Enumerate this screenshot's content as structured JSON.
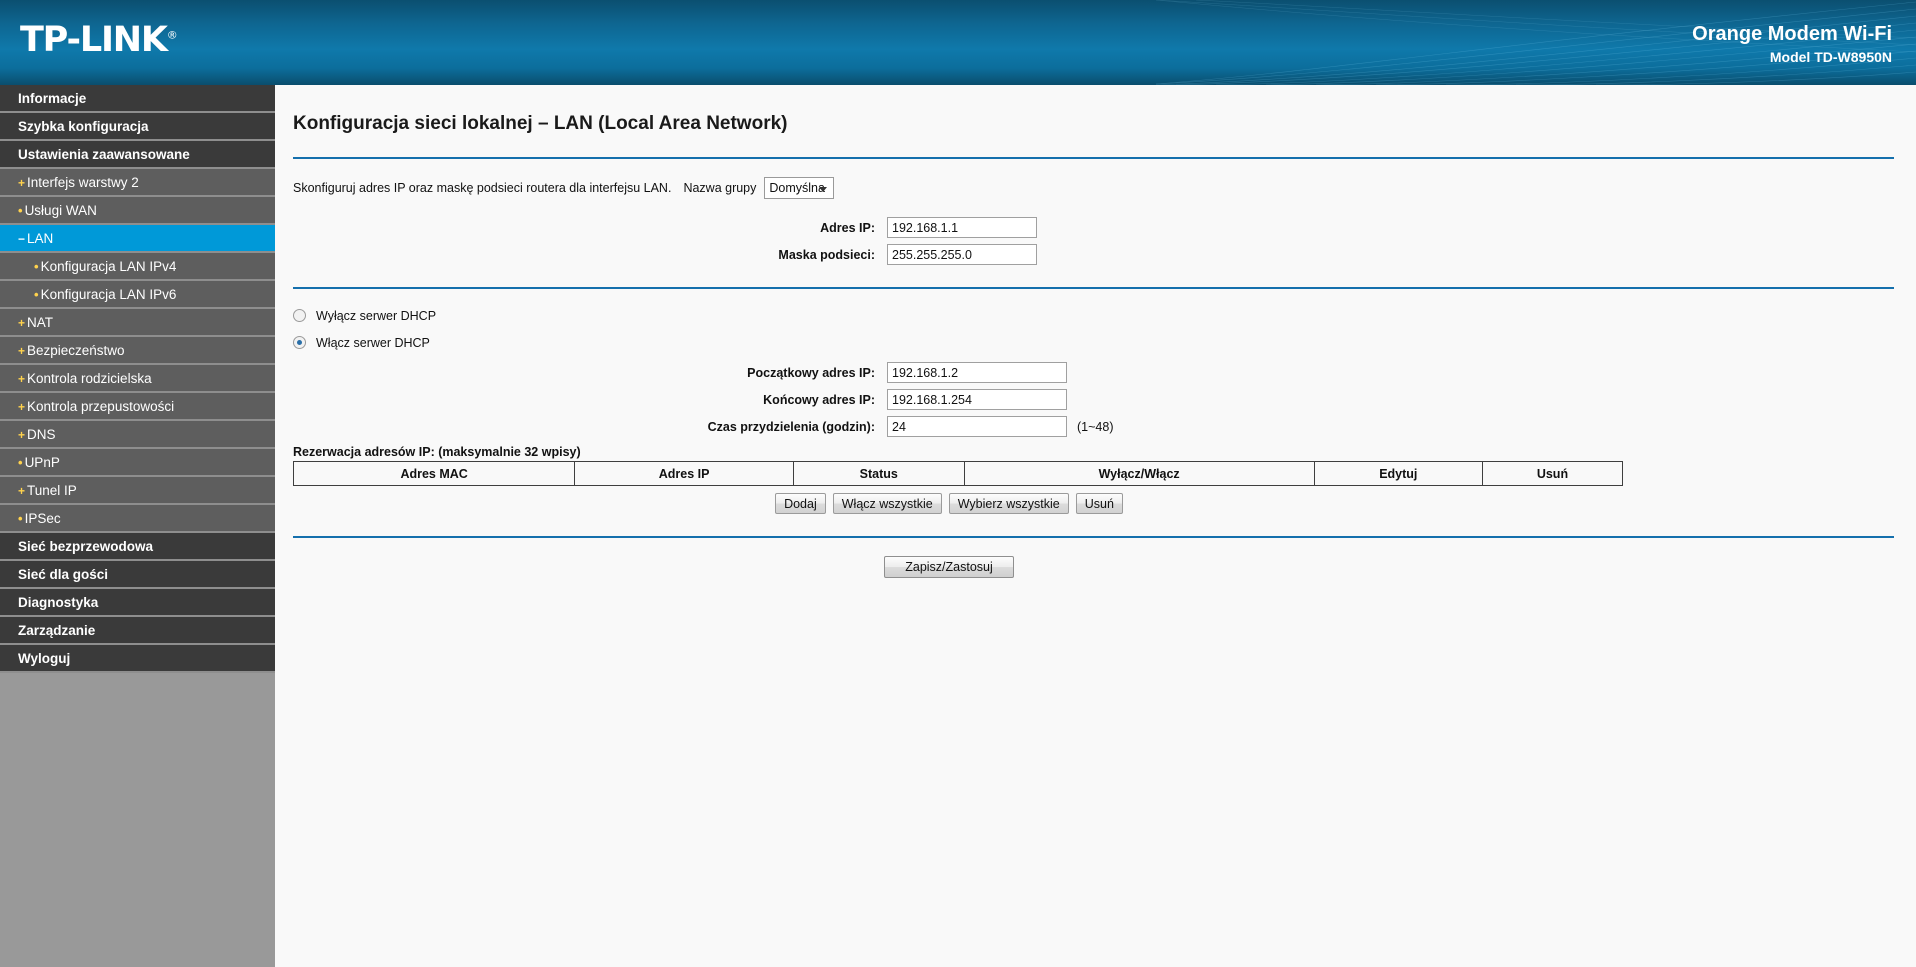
{
  "header": {
    "logo_text": "TP-LINK",
    "logo_trademark": "®",
    "brand_title": "Orange Modem Wi-Fi",
    "brand_model": "Model TD-W8950N",
    "gradient_from": "#0b4f70",
    "gradient_to": "#0f79ab"
  },
  "sidebar": {
    "active_color": "#0099d8",
    "items": [
      {
        "label": "Informacje",
        "marker": "",
        "level": 0
      },
      {
        "label": "Szybka konfiguracja",
        "marker": "",
        "level": 0
      },
      {
        "label": "Ustawienia zaawansowane",
        "marker": "",
        "level": 0
      },
      {
        "label": "Interfejs warstwy 2",
        "marker": "+",
        "level": 1
      },
      {
        "label": "Usługi WAN",
        "marker": "•",
        "level": 1
      },
      {
        "label": "LAN",
        "marker": "−",
        "level": 1,
        "active": true
      },
      {
        "label": "Konfiguracja LAN IPv4",
        "marker": "•",
        "level": 2
      },
      {
        "label": "Konfiguracja LAN IPv6",
        "marker": "•",
        "level": 2
      },
      {
        "label": "NAT",
        "marker": "+",
        "level": 1
      },
      {
        "label": "Bezpieczeństwo",
        "marker": "+",
        "level": 1
      },
      {
        "label": "Kontrola rodzicielska",
        "marker": "+",
        "level": 1
      },
      {
        "label": "Kontrola przepustowości",
        "marker": "+",
        "level": 1
      },
      {
        "label": "DNS",
        "marker": "+",
        "level": 1
      },
      {
        "label": "UPnP",
        "marker": "•",
        "level": 1
      },
      {
        "label": "Tunel IP",
        "marker": "+",
        "level": 1
      },
      {
        "label": "IPSec",
        "marker": "•",
        "level": 1
      },
      {
        "label": "Sieć bezprzewodowa",
        "marker": "",
        "level": 0
      },
      {
        "label": "Sieć dla gości",
        "marker": "",
        "level": 0
      },
      {
        "label": "Diagnostyka",
        "marker": "",
        "level": 0
      },
      {
        "label": "Zarządzanie",
        "marker": "",
        "level": 0
      },
      {
        "label": "Wyloguj",
        "marker": "",
        "level": 0
      }
    ]
  },
  "main": {
    "page_title": "Konfiguracja sieci lokalnej – LAN (Local Area Network)",
    "description": "Skonfiguruj adres IP oraz maskę podsieci routera dla interfejsu LAN.",
    "group_label": "Nazwa grupy",
    "group_value": "Domyślna",
    "ip_label": "Adres IP:",
    "ip_value": "192.168.1.1",
    "mask_label": "Maska podsieci:",
    "mask_value": "255.255.255.0",
    "dhcp_off_label": "Wyłącz serwer DHCP",
    "dhcp_on_label": "Włącz serwer DHCP",
    "dhcp_start_label": "Początkowy adres IP:",
    "dhcp_start_value": "192.168.1.2",
    "dhcp_end_label": "Końcowy adres IP:",
    "dhcp_end_value": "192.168.1.254",
    "lease_label": "Czas przydzielenia (godzin):",
    "lease_value": "24",
    "lease_hint": "(1~48)",
    "reservation_title": "Rezerwacja adresów IP: (maksymalnie 32 wpisy)",
    "table_headers": [
      "Adres MAC",
      "Adres IP",
      "Status",
      "Wyłącz/Włącz",
      "Edytuj",
      "Usuń"
    ],
    "buttons": [
      "Dodaj",
      "Włącz wszystkie",
      "Wybierz wszystkie",
      "Usuń"
    ],
    "apply_label": "Zapisz/Zastosuj"
  }
}
